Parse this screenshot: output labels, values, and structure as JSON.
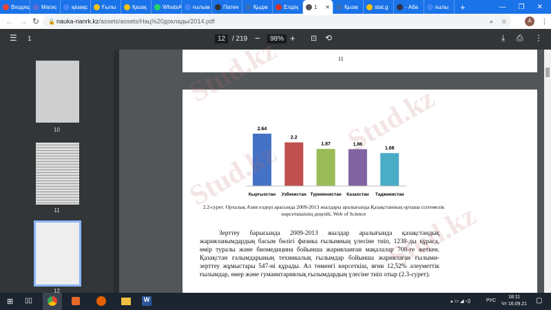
{
  "tabs": [
    {
      "label": "Входящ",
      "color": "#ea4335"
    },
    {
      "label": "Магис",
      "color": "#5f6dd8"
    },
    {
      "label": "қазақс",
      "color": "#4285f4"
    },
    {
      "label": "Ғылы",
      "color": "#f4c20d"
    },
    {
      "label": "Қазақ",
      "color": "#f4c20d"
    },
    {
      "label": "WhatsA",
      "color": "#25d366"
    },
    {
      "label": "ғылым",
      "color": "#4285f4"
    },
    {
      "label": "Патен",
      "color": "#333333"
    },
    {
      "label": "Қыдм",
      "color": "#3b6fb6"
    },
    {
      "label": "Елдің",
      "color": "#d93025"
    },
    {
      "label": "1",
      "color": "#555555",
      "active": true
    },
    {
      "label": "Қызм",
      "color": "#3b6fb6"
    },
    {
      "label": "stat.g",
      "color": "#f4c20d"
    },
    {
      "label": "- Аба",
      "color": "#334"
    },
    {
      "label": "ғылы",
      "color": "#4285f4"
    }
  ],
  "url": {
    "host": "nauka-nanrk.kz",
    "path": "/assets/assets/Нац%20доклады/2014.pdf"
  },
  "avatar": "A",
  "pdf": {
    "title": "1",
    "page": "12",
    "total": "/ 219",
    "zoom": "98%"
  },
  "thumbs": [
    "10",
    "11",
    "12"
  ],
  "page_number": "11",
  "chart_data": {
    "type": "bar",
    "categories": [
      "Кыргызстан",
      "Узбекистан",
      "Туркменистан",
      "Казахстан",
      "Таджикистан"
    ],
    "values": [
      2.64,
      2.2,
      1.87,
      1.86,
      1.66
    ],
    "value_labels": [
      "2.64",
      "2.2",
      "1.87",
      "1.86",
      "1.66"
    ],
    "colors": [
      "#4472c4",
      "#c0504d",
      "#9bbb59",
      "#8064a2",
      "#4bacc6"
    ],
    "ylim": [
      0,
      3
    ]
  },
  "caption": "2.2-сурет. Орталық Азия елдері арасында 2009-2013 жылдары аралығында Қазақстанның орташа сілтемелік көрсеткішінің деңгейі, Web of Science",
  "paragraph": "Зерттеу барысында 2009-2013 жылдар аралығында қазақстандық жарияланымдардың басым бөлігі физика ғылымның үлесіне тиіп, 1238-ды құраса, өмір туралы және биомедицина бойынша жарияланған мақалалар 708-ге жеткен. Қазақстан ғалымдарының техникалық ғылымдар бойынша жариялаған ғылыми-зерттеу жұмыстары 547-ні құрады. Ал төменгі көрсеткіш, яғни 12,52% әлеуметтік ғылымдар, өнер және гуманитариялық ғылымдардың үлесіне тиіп отыр (2.3-сурет).",
  "watermark": "Stud.kz",
  "tray": {
    "lang": "РУС",
    "time": "18:11",
    "date": "Чт 16.09.21"
  }
}
